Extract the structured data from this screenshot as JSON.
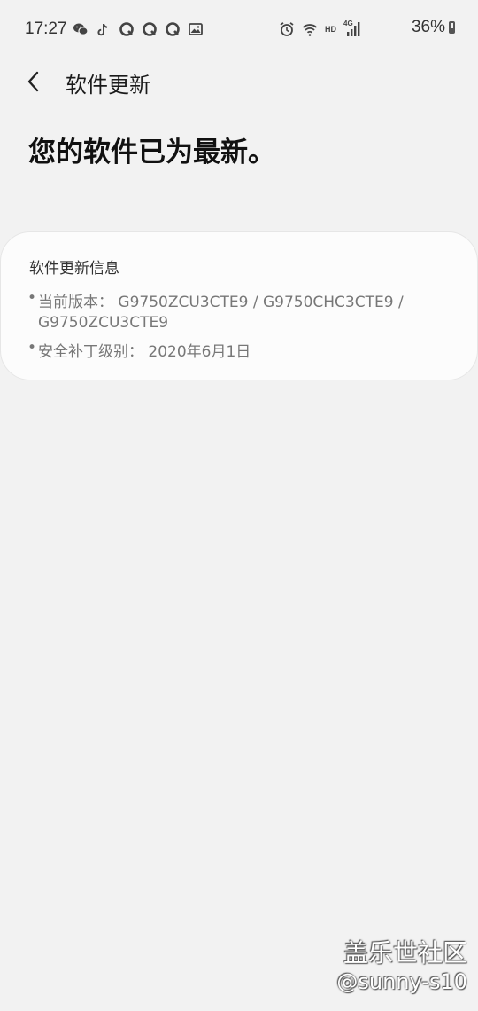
{
  "status_bar": {
    "time": "17:27",
    "battery": "36%",
    "network": "4G",
    "hd": "HD",
    "left_icons": [
      "wechat-icon",
      "tiktok-icon",
      "q-icon",
      "q-icon",
      "q-icon",
      "gallery-icon"
    ],
    "right_icons": [
      "alarm-icon",
      "wifi-icon",
      "hd-icon",
      "signal-icon"
    ]
  },
  "header": {
    "back_icon": "chevron-left-icon",
    "title": "软件更新"
  },
  "main": {
    "message": "您的软件已为最新。"
  },
  "info_card": {
    "title": "软件更新信息",
    "bullet": "•",
    "current_version_line1": "当前版本： G9750ZCU3CTE9 / G9750CHC3CTE9 /",
    "current_version_line2": "G9750ZCU3CTE9",
    "security_patch": "安全补丁级别： 2020年6月1日"
  },
  "watermark": {
    "line1": "盖乐世社区",
    "line2": "@sunny-s10"
  },
  "colors": {
    "background": "#f2f2f2",
    "card": "#fcfcfc",
    "text_primary": "#111111",
    "text_secondary": "#777777"
  }
}
